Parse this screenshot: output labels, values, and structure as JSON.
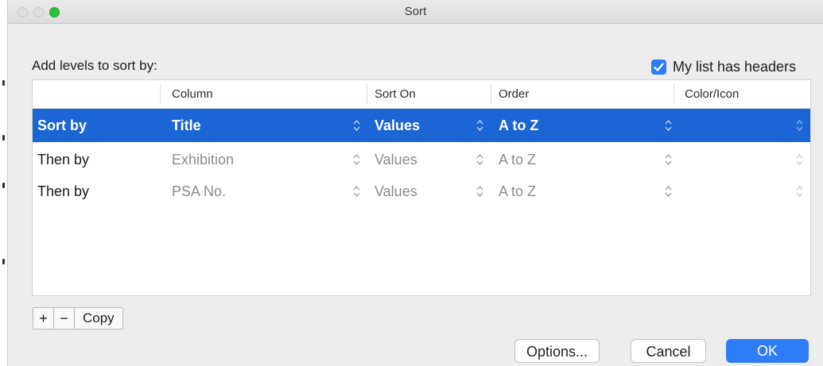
{
  "window": {
    "title": "Sort"
  },
  "dialog": {
    "add_levels_label": "Add levels to sort by:",
    "headers_checkbox": {
      "label": "My list has headers",
      "checked": true
    }
  },
  "table": {
    "columns": [
      "Column",
      "Sort On",
      "Order",
      "Color/Icon"
    ],
    "rows": [
      {
        "level": "Sort by",
        "column": "Title",
        "sort_on": "Values",
        "order": "A to Z",
        "color_icon": "",
        "selected": true
      },
      {
        "level": "Then by",
        "column": "Exhibition",
        "sort_on": "Values",
        "order": "A to Z",
        "color_icon": "",
        "selected": false
      },
      {
        "level": "Then by",
        "column": "PSA No.",
        "sort_on": "Values",
        "order": "A to Z",
        "color_icon": "",
        "selected": false
      }
    ]
  },
  "toolbar": {
    "add_label": "+",
    "remove_label": "−",
    "copy_label": "Copy"
  },
  "buttons": {
    "options": "Options...",
    "cancel": "Cancel",
    "ok": "OK"
  },
  "icons": {
    "checkbox": "checkmark-icon",
    "stepper": "up-down-chevron-icon"
  },
  "colors": {
    "accent": "#2f7df6",
    "selection": "#1b65d4",
    "close_traffic": "#dedede",
    "zoom_traffic": "#2bc03e"
  }
}
